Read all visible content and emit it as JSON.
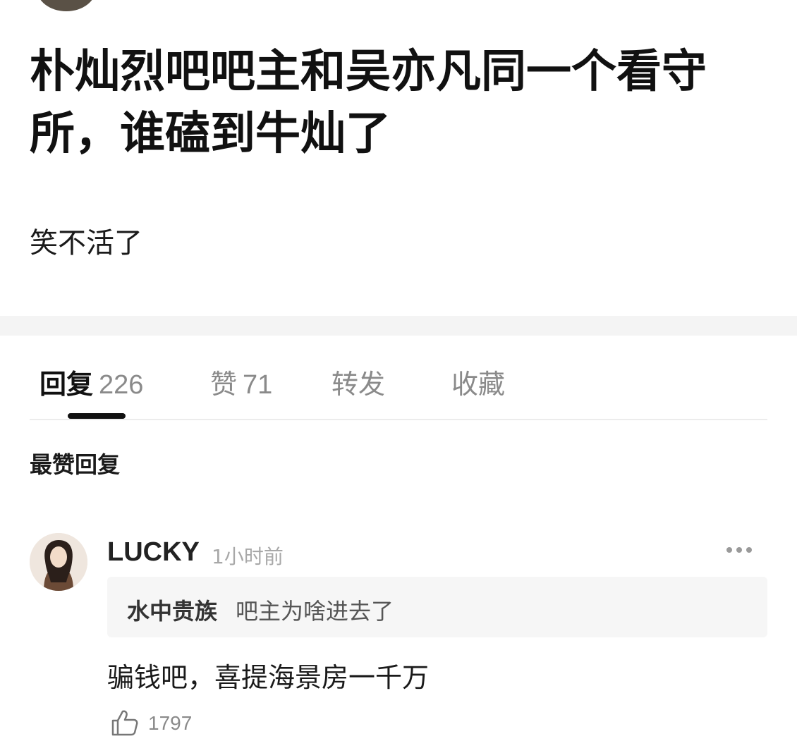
{
  "post": {
    "title": "朴灿烈吧吧主和吴亦凡同一个看守所，谁磕到牛灿了",
    "body": "笑不活了"
  },
  "tabs": [
    {
      "label": "回复",
      "count": "226",
      "active": true
    },
    {
      "label": "赞",
      "count": "71",
      "active": false
    },
    {
      "label": "转发",
      "count": "",
      "active": false
    },
    {
      "label": "收藏",
      "count": "",
      "active": false
    }
  ],
  "section_title": "最赞回复",
  "comment": {
    "username": "LUCKY",
    "time": "1小时前",
    "quote_author": "水中贵族",
    "quote_text": "吧主为啥进去了",
    "text": "骗钱吧，喜提海景房一千万",
    "like_count": "1797",
    "icons": [
      "avatar",
      "more-icon",
      "thumbs-up-icon"
    ]
  },
  "colors": {
    "text_primary": "#111111",
    "text_secondary": "#8a8a8a",
    "quote_bg": "#f6f6f6",
    "band_bg": "#f4f4f4"
  }
}
